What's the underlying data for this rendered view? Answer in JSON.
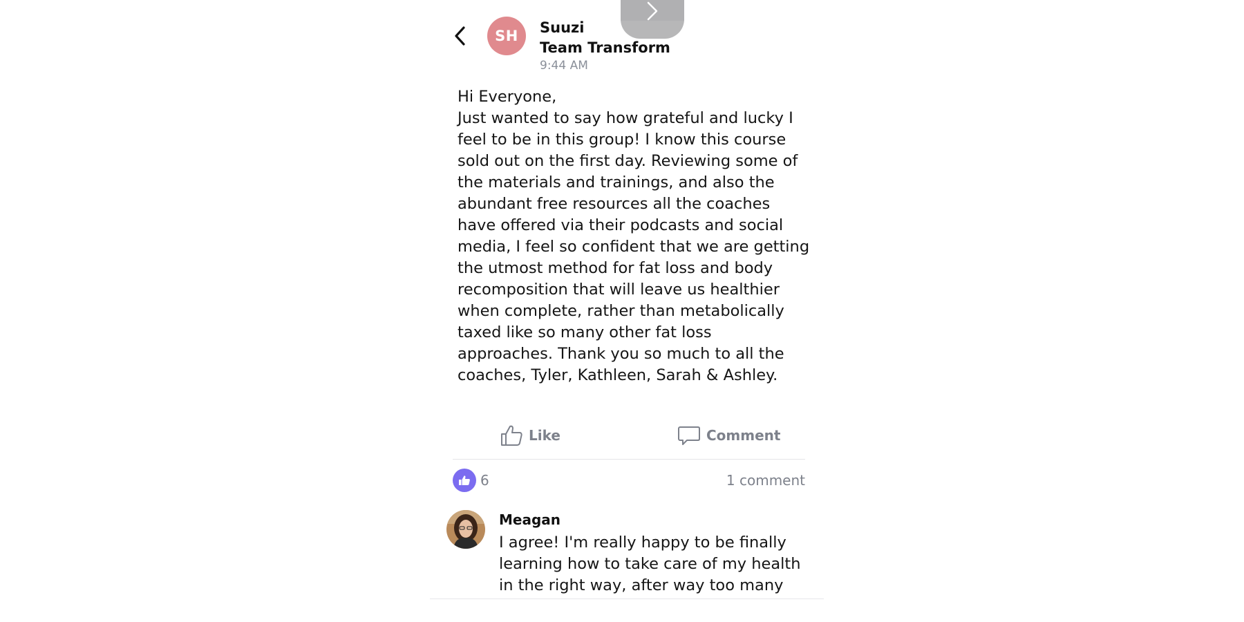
{
  "post": {
    "author_initials": "SH",
    "author_name": "Suuzi\nTeam Transform",
    "time": "9:44 AM",
    "body": "Hi Everyone,\nJust wanted to say how grateful and lucky I feel to be in this group! I know this course sold out on the first day. Reviewing some of the materials and trainings, and also the abundant free resources all the coaches have offered via their podcasts and social media, I feel so confident that we are getting the utmost method for fat loss and body recomposition that will leave us healthier when complete, rather than metabolically taxed like so many other fat loss approaches. Thank you so much to all the coaches, Tyler, Kathleen, Sarah & Ashley."
  },
  "actions": {
    "like_label": "Like",
    "comment_label": "Comment"
  },
  "stats": {
    "like_count": "6",
    "comment_count": "1 comment"
  },
  "comment": {
    "author": "Meagan",
    "text": "I agree! I'm really happy to be finally learning how to take care of my health in the right way, after way too many years"
  },
  "colors": {
    "avatar_bg": "#e08a8e",
    "like_badge": "#7b6cf0",
    "muted_text": "#7d818b"
  },
  "icons": {
    "back": "chevron-left-icon",
    "overlay": "chevron-right-icon",
    "like": "thumbs-up-icon",
    "comment": "speech-bubble-icon"
  }
}
